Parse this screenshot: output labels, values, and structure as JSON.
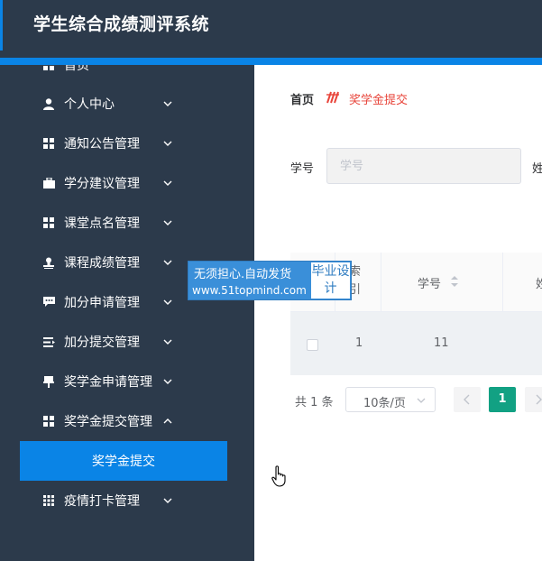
{
  "app": {
    "title": "学生综合成绩测评系统"
  },
  "sidebar": {
    "partial_top_label": "首页",
    "items": [
      {
        "label": "个人中心",
        "icon": "user-icon"
      },
      {
        "label": "通知公告管理",
        "icon": "grid-icon"
      },
      {
        "label": "学分建议管理",
        "icon": "briefcase-icon"
      },
      {
        "label": "课堂点名管理",
        "icon": "grid-icon"
      },
      {
        "label": "课程成绩管理",
        "icon": "stamp-icon"
      },
      {
        "label": "加分申请管理",
        "icon": "chat-icon"
      },
      {
        "label": "加分提交管理",
        "icon": "list-icon"
      },
      {
        "label": "奖学金申请管理",
        "icon": "pin-icon"
      },
      {
        "label": "奖学金提交管理",
        "icon": "grid-icon"
      },
      {
        "label": "疫情打卡管理",
        "icon": "apps-icon"
      }
    ],
    "active_subitem": "奖学金提交"
  },
  "breadcrumb": {
    "home": "首页",
    "current": "奖学金提交"
  },
  "search": {
    "label": "学号",
    "placeholder": "学号",
    "next_label": "姓"
  },
  "table": {
    "headers": {
      "index": "索引",
      "student_no": "学号",
      "next": "姓"
    },
    "rows": [
      {
        "index": "1",
        "student_no": "11"
      }
    ]
  },
  "pagination": {
    "total": "共 1 条",
    "page_size": "10条/页",
    "current_page": "1"
  },
  "watermark": {
    "line1": "无须担心.自动发货",
    "line2": "www.51topmind.com",
    "box": "毕业设计"
  },
  "colors": {
    "header": "#2c3a4b",
    "accent": "#0a84e6",
    "breadcrumb_current": "#e8443a",
    "page_active": "#12a183"
  }
}
